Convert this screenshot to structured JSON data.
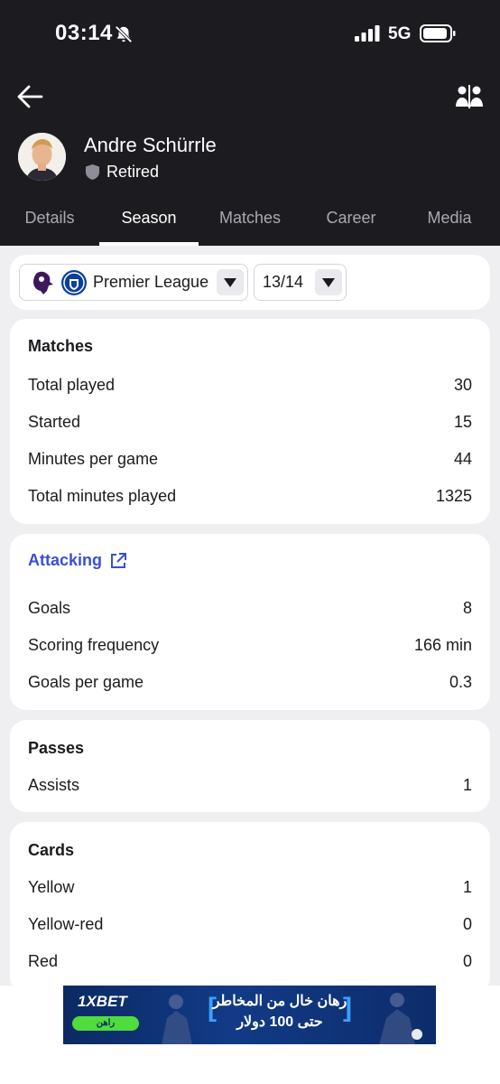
{
  "status_bar": {
    "time": "03:14",
    "network": "5G"
  },
  "player": {
    "name": "Andre Schürrle",
    "status": "Retired"
  },
  "tabs": [
    {
      "label": "Details"
    },
    {
      "label": "Season"
    },
    {
      "label": "Matches"
    },
    {
      "label": "Career"
    },
    {
      "label": "Media"
    }
  ],
  "active_tab": "Season",
  "filters": {
    "league": "Premier League",
    "season": "13/14"
  },
  "sections": {
    "matches": {
      "title": "Matches",
      "rows": [
        {
          "label": "Total played",
          "value": "30"
        },
        {
          "label": "Started",
          "value": "15"
        },
        {
          "label": "Minutes per game",
          "value": "44"
        },
        {
          "label": "Total minutes played",
          "value": "1325"
        }
      ]
    },
    "attacking": {
      "title": "Attacking",
      "rows": [
        {
          "label": "Goals",
          "value": "8"
        },
        {
          "label": "Scoring frequency",
          "value": "166 min"
        },
        {
          "label": "Goals per game",
          "value": "0.3"
        }
      ]
    },
    "passes": {
      "title": "Passes",
      "rows": [
        {
          "label": "Assists",
          "value": "1"
        }
      ]
    },
    "cards": {
      "title": "Cards",
      "rows": [
        {
          "label": "Yellow",
          "value": "1"
        },
        {
          "label": "Yellow-red",
          "value": "0"
        },
        {
          "label": "Red",
          "value": "0"
        }
      ]
    }
  },
  "ad": {
    "brand": "1XBET",
    "cta": "راهن",
    "line1": "رهان خال من المخاطر",
    "line2": "حتى 100 دولار"
  },
  "colors": {
    "header_bg": "#1c1c20",
    "accent_link": "#3a4fd6",
    "page_bg": "#efeff2"
  }
}
